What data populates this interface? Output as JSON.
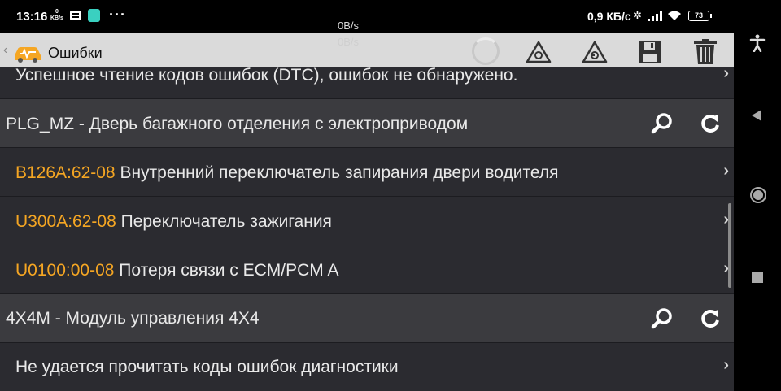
{
  "status_bar": {
    "time": "13:16",
    "kbs_value": "0",
    "kbs_unit": "KB/s",
    "more": "···",
    "net_speed": "0,9 КБ/с",
    "battery": "73",
    "icons": [
      "message-icon",
      "app-icon",
      "bluetooth-icon",
      "signal-icon",
      "wifi-icon",
      "battery-icon"
    ]
  },
  "overlay": {
    "speed_up": "0B/s",
    "speed_down": "0B/s"
  },
  "toolbar": {
    "title": "Ошибки",
    "icons": [
      "back-chevron-icon",
      "car-logo-icon",
      "loading-spinner-icon",
      "warning-triangle-icon",
      "warning-triangle-clear-icon",
      "save-icon",
      "trash-icon"
    ]
  },
  "list": {
    "partial_row": {
      "text": "Успешное чтение кодов ошибок (DTC), ошибок не обнаружено."
    },
    "module1": {
      "title": "PLG_MZ - Дверь багажного отделения с электроприводом"
    },
    "dtc1": {
      "code": "B126A:62-08",
      "desc": "Внутренний переключатель запирания двери водителя"
    },
    "dtc2": {
      "code": "U300A:62-08",
      "desc": "Переключатель зажигания"
    },
    "dtc3": {
      "code": "U0100:00-08",
      "desc": "Потеря связи с ECM/PCM A"
    },
    "module2": {
      "title": "4X4M - Модуль управления 4X4"
    },
    "status_row": {
      "text": "Не удается прочитать коды ошибок диагностики"
    }
  },
  "colors": {
    "accent": "#f5a623",
    "background": "#2b2b30",
    "module_bg": "#3b3b3f",
    "toolbar_bg": "#dadada"
  }
}
